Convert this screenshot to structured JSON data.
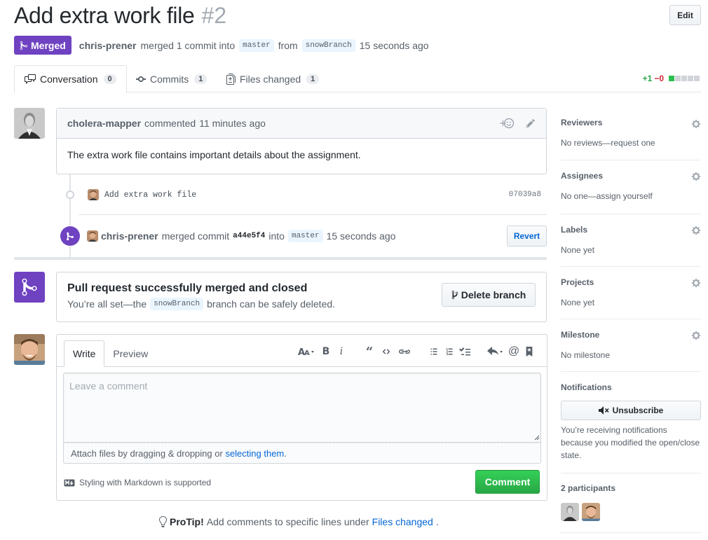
{
  "header": {
    "title": "Add extra work file",
    "number": "#2",
    "edit_label": "Edit",
    "state_label": "Merged",
    "author": "chris-prener",
    "merge_text": "merged 1 commit into",
    "base_branch": "master",
    "from_text": "from",
    "head_branch": "snowBranch",
    "time": "15 seconds ago"
  },
  "tabs": [
    {
      "label": "Conversation",
      "count": "0"
    },
    {
      "label": "Commits",
      "count": "1"
    },
    {
      "label": "Files changed",
      "count": "1"
    }
  ],
  "diffstat": {
    "additions": "+1",
    "deletions": "−0"
  },
  "comment": {
    "author": "cholera-mapper",
    "action": "commented",
    "time": "11 minutes ago",
    "body": "The extra work file contains important details about the assignment."
  },
  "commit": {
    "message": "Add extra work file",
    "sha": "07039a8"
  },
  "merge_event": {
    "author": "chris-prener",
    "text": "merged commit",
    "sha": "a44e5f4",
    "into": "into",
    "branch": "master",
    "time": "15 seconds ago",
    "revert_label": "Revert"
  },
  "merged_box": {
    "title": "Pull request successfully merged and closed",
    "sub_prefix": "You’re all set—the",
    "branch": "snowBranch",
    "sub_suffix": "branch can be safely deleted.",
    "delete_label": "Delete branch"
  },
  "form": {
    "tab_write": "Write",
    "tab_preview": "Preview",
    "placeholder": "Leave a comment",
    "attach_prefix": "Attach files by dragging & dropping or",
    "attach_link": "selecting them",
    "attach_suffix": ".",
    "markdown_note": "Styling with Markdown is supported",
    "submit_label": "Comment"
  },
  "protip": {
    "label": "ProTip!",
    "text": "Add comments to specific lines under",
    "link": "Files changed",
    "suffix": "."
  },
  "sidebar": {
    "reviewers": {
      "title": "Reviewers",
      "value": "No reviews—request one"
    },
    "assignees": {
      "title": "Assignees",
      "value": "No one—assign yourself"
    },
    "labels": {
      "title": "Labels",
      "value": "None yet"
    },
    "projects": {
      "title": "Projects",
      "value": "None yet"
    },
    "milestone": {
      "title": "Milestone",
      "value": "No milestone"
    },
    "notifications": {
      "title": "Notifications",
      "button": "Unsubscribe",
      "note": "You’re receiving notifications because you modified the open/close state."
    },
    "participants": {
      "title": "2 participants"
    }
  },
  "colors": {
    "merged": "#6f42c1",
    "green": "#28a745",
    "red": "#cb2431",
    "link": "#0366d6"
  }
}
